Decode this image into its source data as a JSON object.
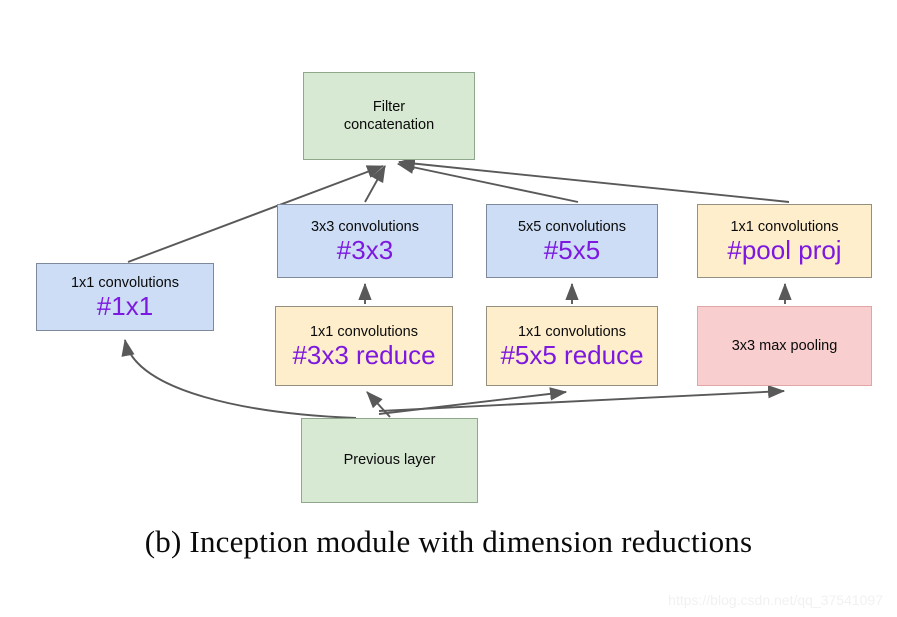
{
  "figure": {
    "caption": "(b) Inception module with dimension reductions",
    "watermark": "https://blog.csdn.net/qq_37541097"
  },
  "colors": {
    "green_fill": "#d7e8d3",
    "blue_fill": "#ccddf5",
    "yellow_fill": "#ffeecc",
    "pink_fill": "#f8cece",
    "accent_text": "#7d18e0",
    "edge_stroke": "#595959",
    "border_gray": "#808080"
  },
  "nodes": {
    "filter_concat": {
      "label": "Filter",
      "label_line2": "concatenation"
    },
    "conv1x1": {
      "label": "1x1 convolutions",
      "accent": "#1x1"
    },
    "conv3x3": {
      "label": "3x3 convolutions",
      "accent": "#3x3"
    },
    "conv5x5": {
      "label": "5x5 convolutions",
      "accent": "#5x5"
    },
    "pool_proj": {
      "label": "1x1 convolutions",
      "accent": "#pool proj"
    },
    "reduce3x3": {
      "label": "1x1 convolutions",
      "accent": "#3x3 reduce"
    },
    "reduce5x5": {
      "label": "1x1 convolutions",
      "accent": "#5x5 reduce"
    },
    "max_pooling": {
      "label": "3x3 max pooling"
    },
    "previous_layer": {
      "label": "Previous layer"
    }
  },
  "edges": [
    {
      "from": "previous_layer",
      "to": "conv1x1",
      "style": "curved"
    },
    {
      "from": "previous_layer",
      "to": "reduce3x3",
      "style": "straight"
    },
    {
      "from": "previous_layer",
      "to": "reduce5x5",
      "style": "straight"
    },
    {
      "from": "previous_layer",
      "to": "max_pooling",
      "style": "straight"
    },
    {
      "from": "reduce3x3",
      "to": "conv3x3",
      "style": "straight"
    },
    {
      "from": "reduce5x5",
      "to": "conv5x5",
      "style": "straight"
    },
    {
      "from": "max_pooling",
      "to": "pool_proj",
      "style": "straight"
    },
    {
      "from": "conv1x1",
      "to": "filter_concat",
      "style": "straight"
    },
    {
      "from": "conv3x3",
      "to": "filter_concat",
      "style": "straight"
    },
    {
      "from": "conv5x5",
      "to": "filter_concat",
      "style": "straight"
    },
    {
      "from": "pool_proj",
      "to": "filter_concat",
      "style": "straight"
    }
  ]
}
